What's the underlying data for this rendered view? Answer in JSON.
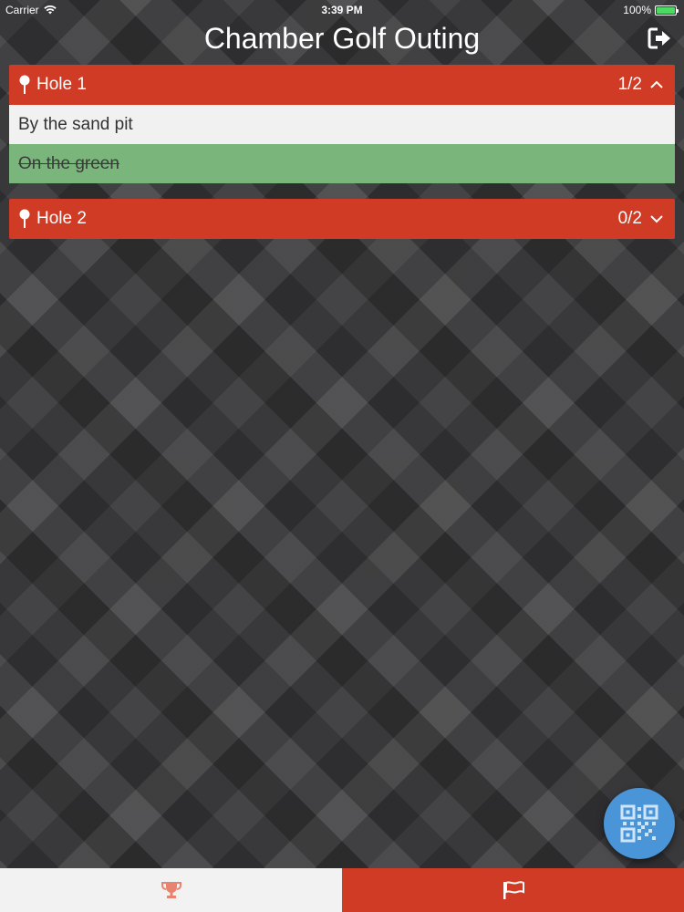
{
  "status_bar": {
    "carrier": "Carrier",
    "time": "3:39 PM",
    "battery": "100%",
    "battery_level": 1.0
  },
  "header": {
    "title": "Chamber Golf Outing",
    "logout_icon": "sign-out-icon"
  },
  "holes": [
    {
      "label": "Hole 1",
      "count": "1/2",
      "expanded": true,
      "items": [
        {
          "text": "By the sand pit",
          "completed": false
        },
        {
          "text": "On the green",
          "completed": true
        }
      ]
    },
    {
      "label": "Hole 2",
      "count": "0/2",
      "expanded": false,
      "items": []
    }
  ],
  "fab": {
    "icon": "qr-code-icon",
    "color": "#4a94d8"
  },
  "tabs": [
    {
      "icon": "trophy-icon",
      "active": false
    },
    {
      "icon": "flag-icon",
      "active": true
    }
  ],
  "colors": {
    "accent": "#d03b25",
    "completed": "#7ab57c",
    "open_item": "#f1f1f1"
  }
}
